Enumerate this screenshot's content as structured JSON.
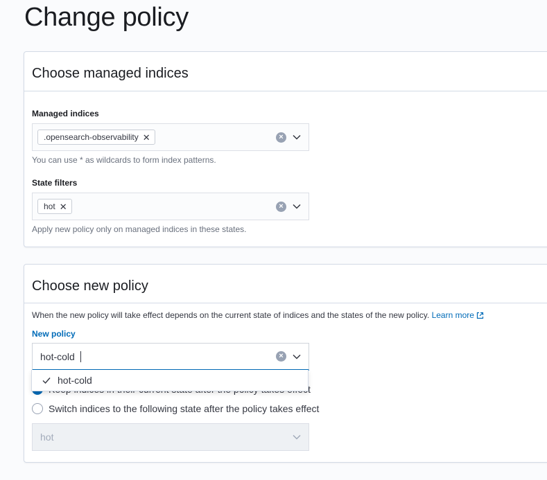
{
  "page": {
    "title": "Change policy"
  },
  "indices_panel": {
    "title": "Choose managed indices",
    "managed_indices": {
      "label": "Managed indices",
      "selected": [
        ".opensearch-observability"
      ],
      "help": "You can use * as wildcards to form index patterns."
    },
    "state_filters": {
      "label": "State filters",
      "selected": [
        "hot"
      ],
      "help": "Apply new policy only on managed indices in these states."
    }
  },
  "policy_panel": {
    "title": "Choose new policy",
    "description": "When the new policy will take effect depends on the current state of indices and the states of the new policy.",
    "learn_more": "Learn more",
    "new_policy": {
      "label": "New policy",
      "value": "hot-cold",
      "options": [
        {
          "label": "hot-cold",
          "selected": true
        }
      ]
    },
    "radio_keep": {
      "label": "Keep indices in their current state after the policy takes effect",
      "checked": true
    },
    "radio_switch": {
      "label": "Switch indices to the following state after the policy takes effect",
      "checked": false
    },
    "state_select": {
      "value": "hot",
      "disabled": true
    }
  },
  "icons": {
    "clear": "clear-circle-icon",
    "chevron": "chevron-down-icon",
    "remove": "close-icon",
    "check": "check-icon",
    "external": "external-link-icon"
  },
  "colors": {
    "accent": "#006bb8",
    "text": "#1a1c21",
    "subdued": "#69707d",
    "border": "#d3dae6"
  }
}
